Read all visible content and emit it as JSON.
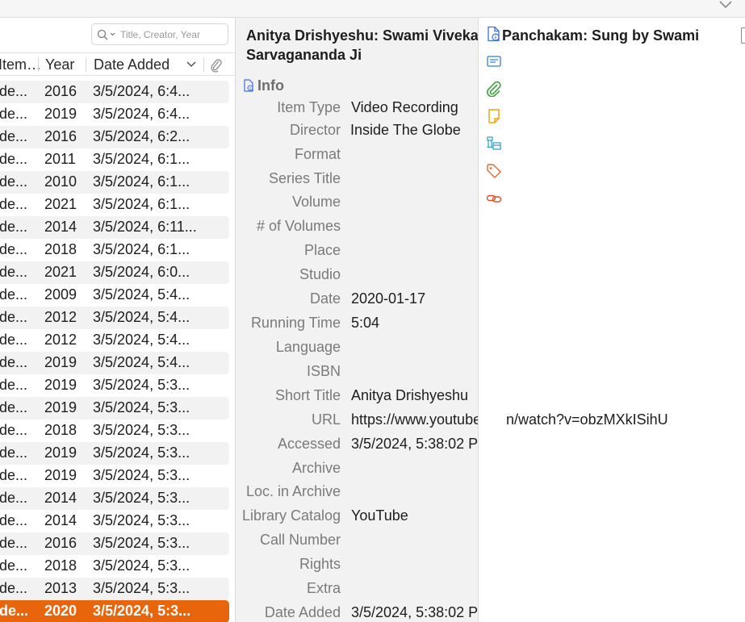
{
  "search": {
    "placeholder": "Title, Creator, Year"
  },
  "columns": {
    "item_header": "Item…",
    "year_header": "Year",
    "date_added_header": "Date Added"
  },
  "rows": [
    {
      "c1": "de...",
      "year": "2016",
      "date": "3/5/2024, 6:4..."
    },
    {
      "c1": "de...",
      "year": "2019",
      "date": "3/5/2024, 6:4..."
    },
    {
      "c1": "de...",
      "year": "2016",
      "date": "3/5/2024, 6:2..."
    },
    {
      "c1": "de...",
      "year": "2011",
      "date": "3/5/2024, 6:1..."
    },
    {
      "c1": "de...",
      "year": "2010",
      "date": "3/5/2024, 6:1..."
    },
    {
      "c1": "de...",
      "year": "2021",
      "date": "3/5/2024, 6:1..."
    },
    {
      "c1": "de...",
      "year": "2014",
      "date": "3/5/2024, 6:11..."
    },
    {
      "c1": "de...",
      "year": "2018",
      "date": "3/5/2024, 6:1..."
    },
    {
      "c1": "de...",
      "year": "2021",
      "date": "3/5/2024, 6:0..."
    },
    {
      "c1": "de...",
      "year": "2009",
      "date": "3/5/2024, 5:4..."
    },
    {
      "c1": "de...",
      "year": "2012",
      "date": "3/5/2024, 5:4..."
    },
    {
      "c1": "de...",
      "year": "2012",
      "date": "3/5/2024, 5:4..."
    },
    {
      "c1": "de...",
      "year": "2019",
      "date": "3/5/2024, 5:4..."
    },
    {
      "c1": "de...",
      "year": "2019",
      "date": "3/5/2024, 5:3..."
    },
    {
      "c1": "de...",
      "year": "2019",
      "date": "3/5/2024, 5:3..."
    },
    {
      "c1": "de...",
      "year": "2018",
      "date": "3/5/2024, 5:3..."
    },
    {
      "c1": "de...",
      "year": "2019",
      "date": "3/5/2024, 5:3..."
    },
    {
      "c1": "de...",
      "year": "2019",
      "date": "3/5/2024, 5:3..."
    },
    {
      "c1": "de...",
      "year": "2014",
      "date": "3/5/2024, 5:3..."
    },
    {
      "c1": "de...",
      "year": "2014",
      "date": "3/5/2024, 5:3..."
    },
    {
      "c1": "de...",
      "year": "2016",
      "date": "3/5/2024, 5:3..."
    },
    {
      "c1": "de...",
      "year": "2018",
      "date": "3/5/2024, 5:3..."
    },
    {
      "c1": "de...",
      "year": "2013",
      "date": "3/5/2024, 5:3..."
    },
    {
      "c1": "de...",
      "year": "2020",
      "date": "3/5/2024, 5:3..."
    }
  ],
  "item": {
    "title_line1": "Anitya Drishyeshu: Swami Vivekan",
    "title_line1_overflow": "a Panchakam: Sung by Swami",
    "title_line2": "Sarvagananda Ji",
    "info_label": "Info",
    "fields": [
      {
        "label": "Item Type",
        "value": "Video Recording"
      },
      {
        "label": "Director",
        "value": "Inside The Globe"
      },
      {
        "label": "Format",
        "value": ""
      },
      {
        "label": "Series Title",
        "value": ""
      },
      {
        "label": "Volume",
        "value": ""
      },
      {
        "label": "# of Volumes",
        "value": ""
      },
      {
        "label": "Place",
        "value": ""
      },
      {
        "label": "Studio",
        "value": ""
      },
      {
        "label": "Date",
        "value": "2020-01-17"
      },
      {
        "label": "Running Time",
        "value": "5:04"
      },
      {
        "label": "Language",
        "value": ""
      },
      {
        "label": "ISBN",
        "value": ""
      },
      {
        "label": "Short Title",
        "value": "Anitya Drishyeshu"
      },
      {
        "label": "URL",
        "value": "https://www.youtube"
      },
      {
        "label": "Accessed",
        "value": "3/5/2024, 5:38:02 P"
      },
      {
        "label": "Archive",
        "value": ""
      },
      {
        "label": "Loc. in Archive",
        "value": ""
      },
      {
        "label": "Library Catalog",
        "value": "YouTube"
      },
      {
        "label": "Call Number",
        "value": ""
      },
      {
        "label": "Rights",
        "value": ""
      },
      {
        "label": "Extra",
        "value": ""
      },
      {
        "label": "Date Added",
        "value": "3/5/2024, 5:38:02 P"
      }
    ],
    "url_overflow": "n/watch?v=obzMXkISihU"
  },
  "colors": {
    "selection": "#e8650c",
    "info_icon": "#3d6fe0",
    "abstract_icon": "#2f7de1",
    "attachment_icon": "#3aa43a",
    "notes_icon": "#f2a100",
    "libraries_icon": "#2a9dc9",
    "tags_icon": "#e8672a",
    "related_icon": "#d9532a"
  },
  "sidenav": [
    "info-icon",
    "abstract-icon",
    "attachments-icon",
    "notes-icon",
    "libraries-collections-icon",
    "tags-icon",
    "related-icon"
  ]
}
